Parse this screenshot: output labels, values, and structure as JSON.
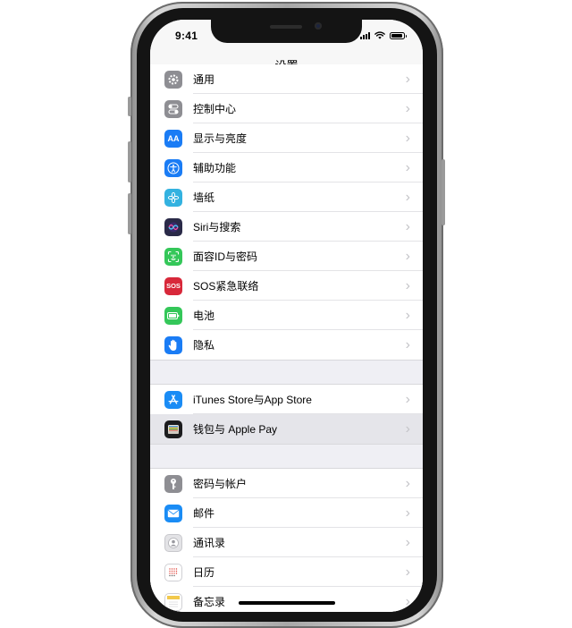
{
  "status_bar": {
    "time": "9:41"
  },
  "nav": {
    "title": "设置"
  },
  "groups": [
    {
      "items": [
        {
          "label": "通用",
          "icon": "gear-icon",
          "color": "#8e8e93"
        },
        {
          "label": "控制中心",
          "icon": "toggles-icon",
          "color": "#8e8e93"
        },
        {
          "label": "显示与亮度",
          "icon": "text-size-icon",
          "color": "#1a7cf5",
          "glyph": "AA"
        },
        {
          "label": "辅助功能",
          "icon": "accessibility-icon",
          "color": "#1a7cf5"
        },
        {
          "label": "墙纸",
          "icon": "flower-icon",
          "color": "#33b2e0"
        },
        {
          "label": "Siri与搜索",
          "icon": "siri-icon",
          "color": "#2a2a48"
        },
        {
          "label": "面容ID与密码",
          "icon": "face-id-icon",
          "color": "#34c759"
        },
        {
          "label": "SOS紧急联络",
          "icon": "sos-icon",
          "color": "#d8283a",
          "glyph": "SOS"
        },
        {
          "label": "电池",
          "icon": "battery-icon",
          "color": "#34c759"
        },
        {
          "label": "隐私",
          "icon": "hand-icon",
          "color": "#1a7cf5"
        }
      ]
    },
    {
      "items": [
        {
          "label": "iTunes Store与App Store",
          "icon": "app-store-icon",
          "color": "#1a8cf5"
        },
        {
          "label": "钱包与 Apple Pay",
          "icon": "wallet-icon",
          "color": "#1c1c1e",
          "selected": true
        }
      ]
    },
    {
      "items": [
        {
          "label": "密码与帐户",
          "icon": "key-icon",
          "color": "#8e8e93"
        },
        {
          "label": "邮件",
          "icon": "mail-icon",
          "color": "#1a8cf5"
        },
        {
          "label": "通讯录",
          "icon": "contacts-icon",
          "color": "#cfcfd4"
        },
        {
          "label": "日历",
          "icon": "calendar-icon",
          "color": "#ffffff"
        },
        {
          "label": "备忘录",
          "icon": "notes-icon",
          "color": "#f2c94c"
        }
      ]
    }
  ]
}
